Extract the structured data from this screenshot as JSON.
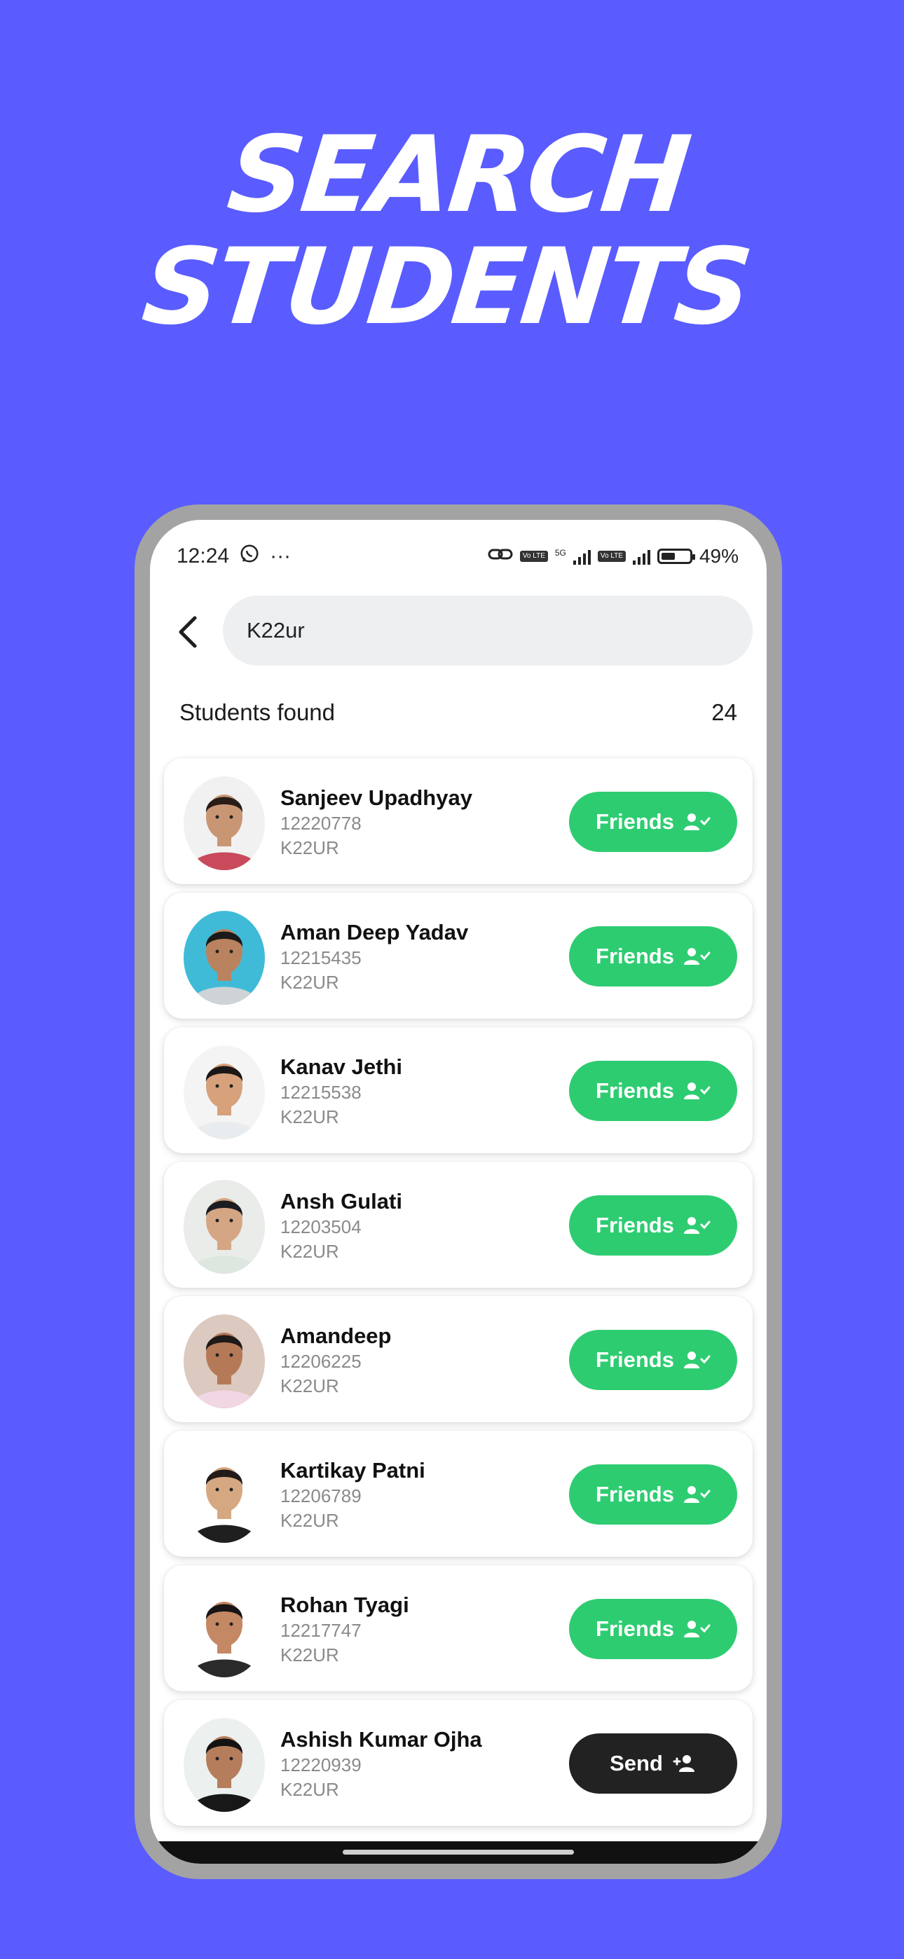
{
  "headline": {
    "line1": "SEARCH",
    "line2": "STUDENTS"
  },
  "status_bar": {
    "time": "12:24",
    "more": "···",
    "network_badge": "Vo LTE",
    "net_type": "5G",
    "battery_percent": "49%",
    "battery_level": 0.49
  },
  "search": {
    "value": "K22ur",
    "placeholder": ""
  },
  "results": {
    "label": "Students found",
    "count": "24"
  },
  "students": [
    {
      "name": "Sanjeev Upadhyay",
      "id": "12220778",
      "section": "K22UR",
      "action": "Friends",
      "action_type": "friends",
      "avatar_bg": "#f1f1f1",
      "skin": "#c99674",
      "hair": "#2a1d17",
      "shirt": "#c84a5b"
    },
    {
      "name": "Aman Deep Yadav",
      "id": "12215435",
      "section": "K22UR",
      "action": "Friends",
      "action_type": "friends",
      "avatar_bg": "#3fbbd8",
      "skin": "#b9835f",
      "hair": "#1b1a1a",
      "shirt": "#cfd3d6"
    },
    {
      "name": "Kanav Jethi",
      "id": "12215538",
      "section": "K22UR",
      "action": "Friends",
      "action_type": "friends",
      "avatar_bg": "#f4f4f4",
      "skin": "#d6a17b",
      "hair": "#1a1716",
      "shirt": "#e9ecee"
    },
    {
      "name": "Ansh Gulati",
      "id": "12203504",
      "section": "K22UR",
      "action": "Friends",
      "action_type": "friends",
      "avatar_bg": "#e9ece8",
      "skin": "#d5a684",
      "hair": "#1c1d22",
      "shirt": "#dde6df"
    },
    {
      "name": "Amandeep",
      "id": "12206225",
      "section": "K22UR",
      "action": "Friends",
      "action_type": "friends",
      "avatar_bg": "#dcc9c0",
      "skin": "#b47a58",
      "hair": "#1d1a18",
      "shirt": "#f1d6e3"
    },
    {
      "name": "Kartikay Patni",
      "id": "12206789",
      "section": "K22UR",
      "action": "Friends",
      "action_type": "friends",
      "avatar_bg": "#ffffff",
      "skin": "#d6a882",
      "hair": "#221b19",
      "shirt": "#1f1f1f"
    },
    {
      "name": "Rohan Tyagi",
      "id": "12217747",
      "section": "K22UR",
      "action": "Friends",
      "action_type": "friends",
      "avatar_bg": "#ffffff",
      "skin": "#c48864",
      "hair": "#171515",
      "shirt": "#2a2a2a"
    },
    {
      "name": "Ashish Kumar Ojha",
      "id": "12220939",
      "section": "K22UR",
      "action": "Send",
      "action_type": "send",
      "avatar_bg": "#ecf0ee",
      "skin": "#b67d5c",
      "hair": "#141313",
      "shirt": "#181818"
    }
  ],
  "icons": {
    "back": "chevron-left-icon",
    "friends": "user-check-icon",
    "send": "user-plus-icon",
    "whatsapp": "whatsapp-icon",
    "link": "link-icon"
  },
  "colors": {
    "background": "#5a5cff",
    "friends_button": "#2ecc71",
    "send_button": "#222222"
  }
}
